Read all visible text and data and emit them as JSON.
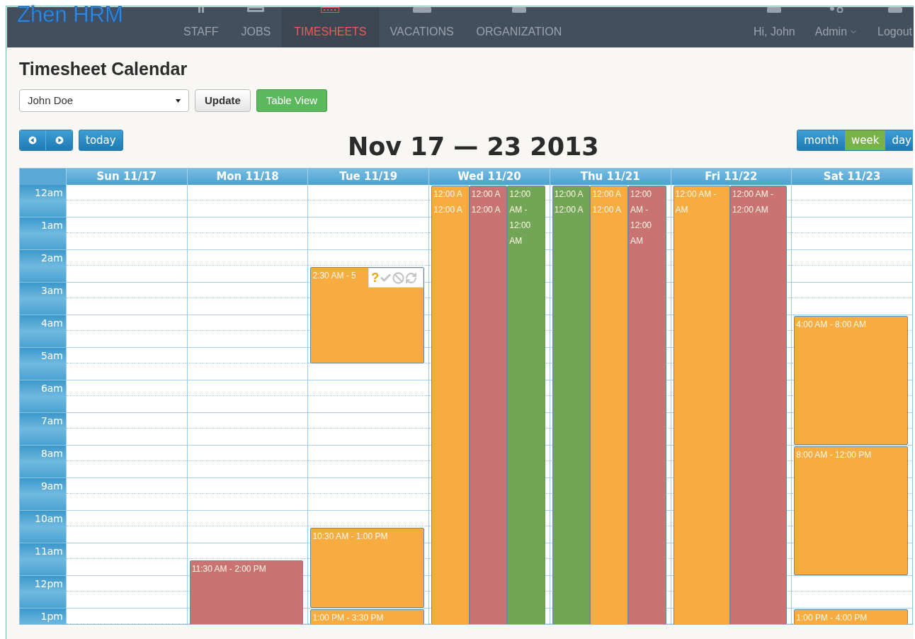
{
  "app": {
    "logo": "Zhen HRM"
  },
  "nav": {
    "items": [
      {
        "label": "STAFF",
        "selected": false
      },
      {
        "label": "JOBS",
        "selected": false
      },
      {
        "label": "TIMESHEETS",
        "selected": true
      },
      {
        "label": "VACATIONS",
        "selected": false
      },
      {
        "label": "ORGANIZATION",
        "selected": false
      }
    ],
    "right": [
      {
        "label": "Hi, John",
        "menu": false
      },
      {
        "label": "Admin",
        "menu": true
      },
      {
        "label": "Logout",
        "menu": false
      }
    ]
  },
  "page": {
    "title": "Timesheet Calendar",
    "employee_select": {
      "value": "John Doe"
    },
    "update_button": "Update",
    "table_view_button": "Table View"
  },
  "toolbar": {
    "today": "today",
    "title": "Nov 17 — 23 2013",
    "views": [
      {
        "label": "month",
        "selected": false
      },
      {
        "label": "week",
        "selected": true
      },
      {
        "label": "day",
        "selected": false
      }
    ]
  },
  "calendar": {
    "hours": [
      "12am",
      "1am",
      "2am",
      "3am",
      "4am",
      "5am",
      "6am",
      "7am",
      "8am",
      "9am",
      "10am",
      "11am",
      "12pm",
      "1pm"
    ],
    "days": [
      {
        "header": "Sun 11/17"
      },
      {
        "header": "Mon 11/18",
        "lanes": [
          [
            {
              "lines": [
                "11:30 AM - 2:00 PM"
              ],
              "color": "#c97472"
            }
          ]
        ]
      },
      {
        "header": "Tue 11/19",
        "lanes": [
          [
            {
              "lines": [
                "2:30 AM - 5"
              ],
              "color": "#f7ac42",
              "actions_popup": {
                "mark": "?"
              }
            },
            {
              "lines": [
                "10:30 AM - 1:00 PM"
              ],
              "color": "#f7ac42"
            },
            {
              "lines": [
                "1:00 PM - 3:30 PM"
              ],
              "color": "#f7ac42"
            }
          ]
        ]
      },
      {
        "header": "Wed 11/20",
        "lanes": [
          [
            {
              "lines": [
                "12:00 A",
                "12:00 A"
              ],
              "color": "#f7ac42"
            }
          ],
          [
            {
              "lines": [
                "12:00 A",
                "12:00 A"
              ],
              "color": "#c97472"
            }
          ],
          [
            {
              "lines": [
                "12:00",
                "AM -",
                "12:00",
                "AM"
              ],
              "color": "#72a556"
            }
          ]
        ]
      },
      {
        "header": "Thu 11/21",
        "lanes": [
          [
            {
              "lines": [
                "12:00 A",
                "12:00 A"
              ],
              "color": "#72a556"
            }
          ],
          [
            {
              "lines": [
                "12:00 A",
                "12:00 A"
              ],
              "color": "#f7ac42"
            }
          ],
          [
            {
              "lines": [
                "12:00",
                "AM -",
                "12:00",
                "AM"
              ],
              "color": "#c97472"
            }
          ]
        ]
      },
      {
        "header": "Fri 11/22",
        "lanes": [
          [
            {
              "lines": [
                "12:00 AM -",
                "AM"
              ],
              "color": "#f7ac42"
            }
          ],
          [
            {
              "lines": [
                "12:00 AM -",
                "12:00 AM"
              ],
              "color": "#c97472"
            }
          ]
        ]
      },
      {
        "header": "Sat 11/23",
        "lanes": [
          [
            {
              "lines": [
                "4:00 AM - 8:00 AM"
              ],
              "color": "#f7ac42"
            },
            {
              "lines": [
                "8:00 AM - 12:00 PM"
              ],
              "color": "#f7ac42"
            },
            {
              "lines": [
                "1:00 PM - 4:00 PM"
              ],
              "color": "#f7ac42"
            }
          ]
        ]
      }
    ]
  }
}
